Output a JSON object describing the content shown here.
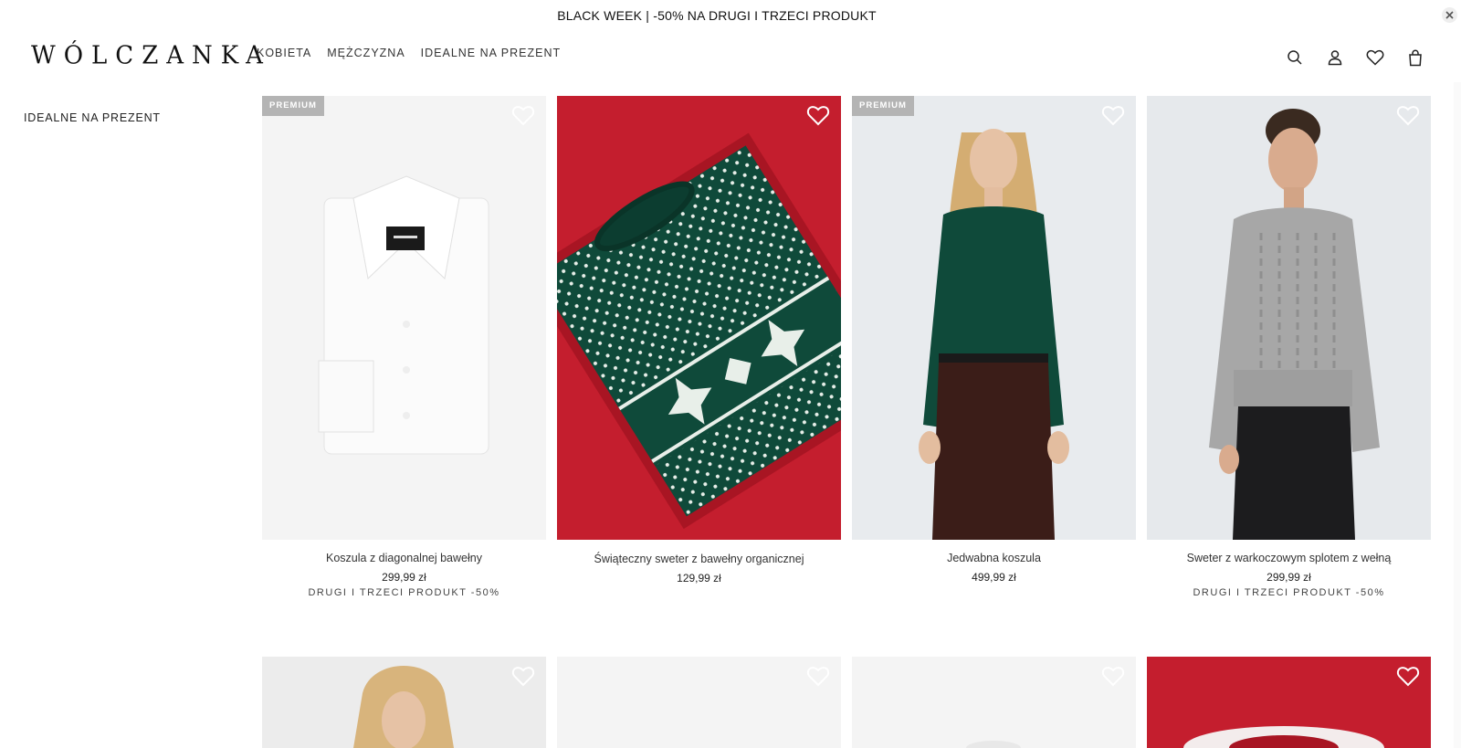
{
  "promo_bar": {
    "text": "BLACK WEEK | -50% NA DRUGI I TRZECI PRODUKT"
  },
  "header": {
    "logo": "WÓLCZANKA",
    "nav": [
      "KOBIETA",
      "MĘŻCZYZNA",
      "IDEALNE NA PREZENT"
    ]
  },
  "sidebar": {
    "category": "IDEALNE NA PREZENT"
  },
  "products": [
    {
      "badge": "PREMIUM",
      "name": "Koszula z diagonalnej bawełny",
      "price": "299,99 zł",
      "promo": "DRUGI I TRZECI PRODUKT -50%"
    },
    {
      "badge": "",
      "name": "Świąteczny sweter z bawełny organicznej",
      "price": "129,99 zł",
      "promo": ""
    },
    {
      "badge": "PREMIUM",
      "name": "Jedwabna koszula",
      "price": "499,99 zł",
      "promo": ""
    },
    {
      "badge": "",
      "name": "Sweter z warkoczowym splotem z wełną",
      "price": "299,99 zł",
      "promo": "DRUGI I TRZECI PRODUKT -50%"
    }
  ],
  "colors": {
    "accent_red": "#c41e2e",
    "sweater_green": "#0f4a3a",
    "badge_gray": "#b4b4b4"
  }
}
